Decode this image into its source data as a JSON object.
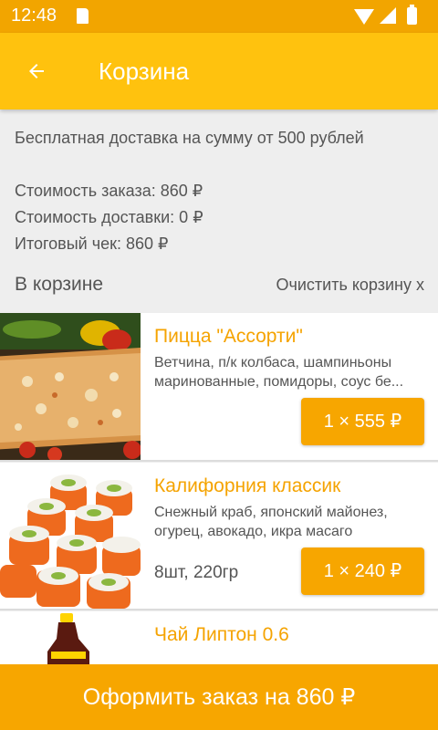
{
  "status_bar": {
    "time": "12:48"
  },
  "app_bar": {
    "title": "Корзина"
  },
  "info": {
    "free_delivery": "Бесплатная доставка на сумму от 500 рублей",
    "order_cost": "Стоимость заказа: 860 ₽",
    "delivery_cost": "Стоимость доставки: 0 ₽",
    "total": "Итоговый чек: 860 ₽"
  },
  "cart": {
    "heading": "В корзине",
    "clear_label": "Очистить корзину x",
    "items": [
      {
        "name": "Пицца \"Ассорти\"",
        "description": "Ветчина, п/к колбаса, шампиньоны маринованные, помидоры, соус бе...",
        "weight": "",
        "quantity_price": "1 × 555 ₽"
      },
      {
        "name": "Калифорния классик",
        "description": "Снежный краб, японский майонез, огурец, авокадо, икра масаго",
        "weight": "8шт, 220гр",
        "quantity_price": "1 × 240 ₽"
      },
      {
        "name": "Чай Липтон 0.6"
      }
    ]
  },
  "checkout": {
    "label": "Оформить заказ на 860 ₽"
  },
  "colors": {
    "accent": "#ffc20e",
    "button": "#f7a600",
    "status_bar": "#f2a500",
    "title_text": "#f5a300"
  }
}
